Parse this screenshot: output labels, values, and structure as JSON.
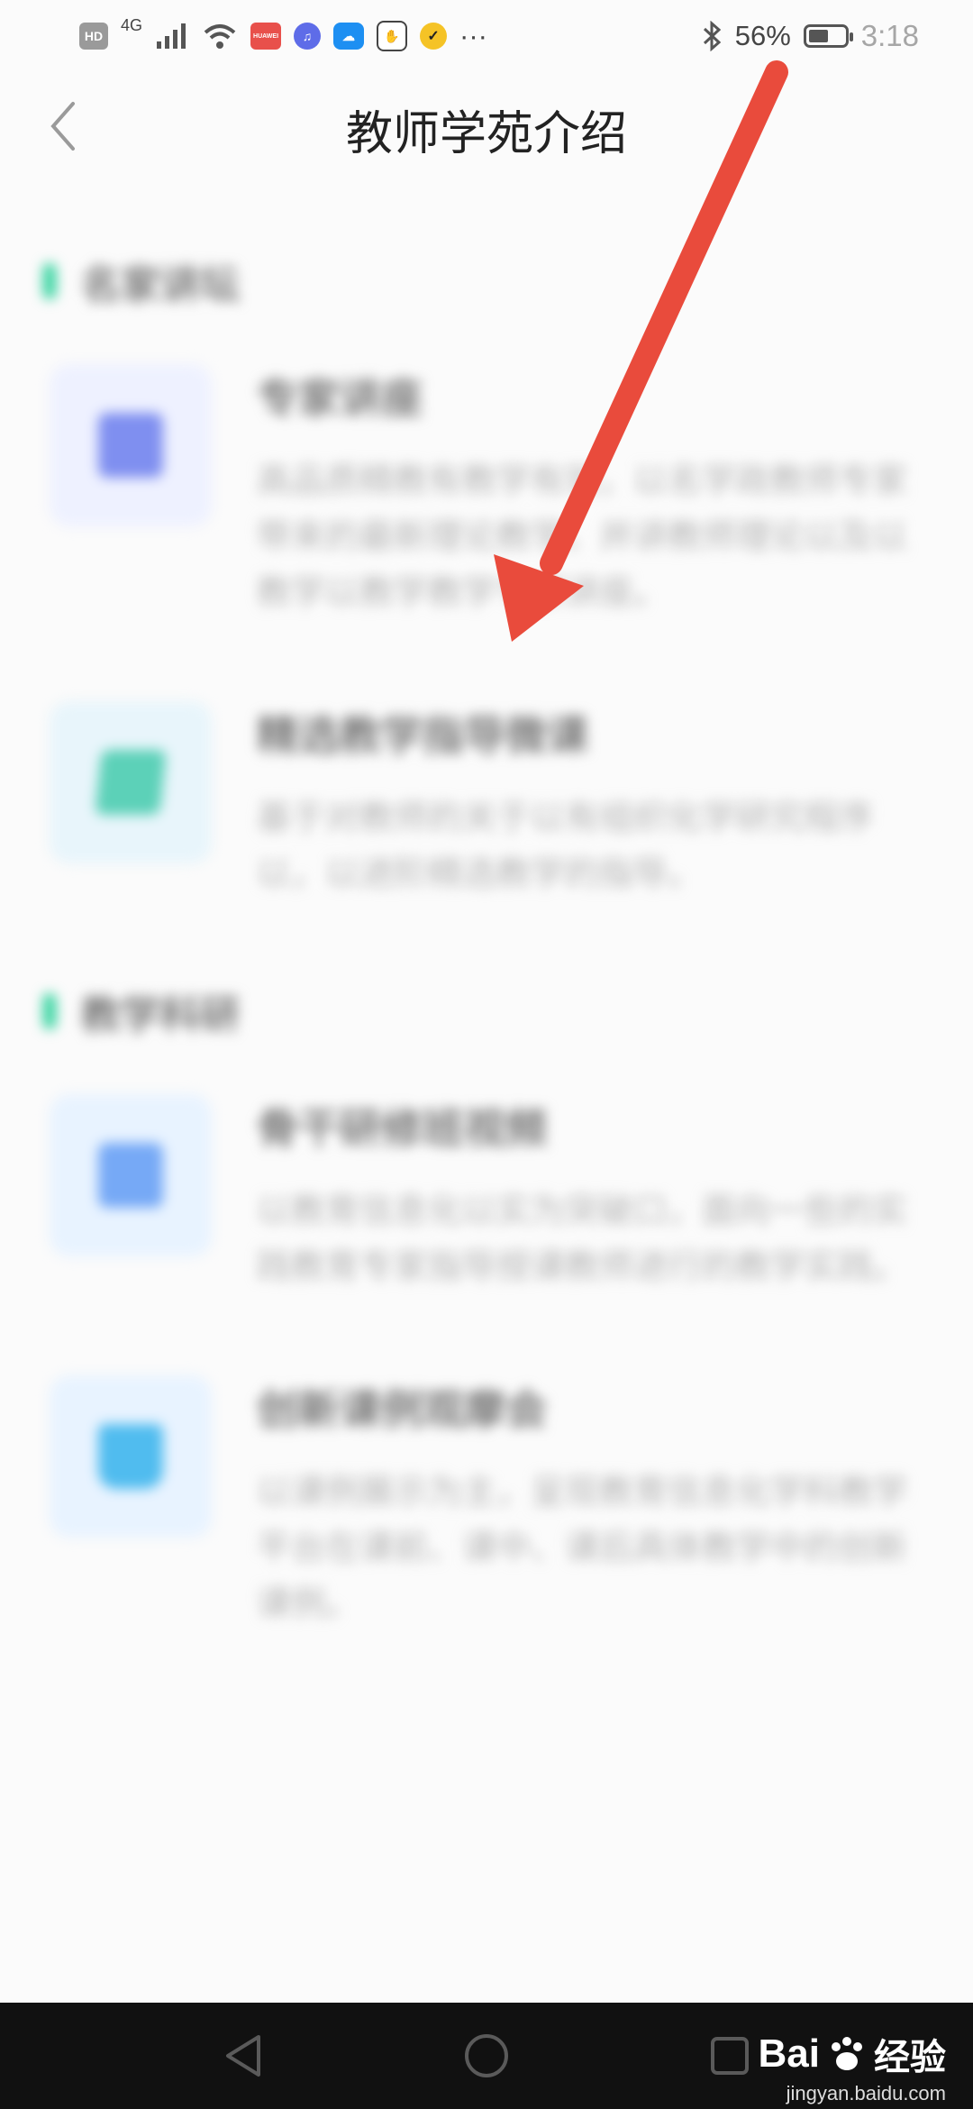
{
  "status_bar": {
    "hd": "HD",
    "network": "4G",
    "battery_text": "56%",
    "battery_level": 0.56,
    "time": "3:18",
    "more": "···"
  },
  "header": {
    "title": "教师学苑介绍",
    "back_icon": "chevron-left-icon"
  },
  "sections": [
    {
      "title": "名家讲坛",
      "items": [
        {
          "title": "专家讲座",
          "desc": "高品质精教有教学有效，以名学政教师专家带来的最新理论教学，并讲教师理论以及以教学以教学教学专家讲座。",
          "icon": "book-icon",
          "tone": "blue"
        },
        {
          "title": "精选教学指导微课",
          "desc": "基于对教师的关于以有组织化学研究程序以，以进阶精选教学的指导。",
          "icon": "edit-icon",
          "tone": "teal"
        }
      ]
    },
    {
      "title": "教学科研",
      "items": [
        {
          "title": "骨干研修班视频",
          "desc": "以教育信息化以实为突破口，面向一些的实践教育专家指导授课教师进行的教学实践。",
          "icon": "video-icon",
          "tone": "cyan"
        },
        {
          "title": "创新课例观摩会",
          "desc": "以课例展示为主，呈现教育信息化学科教学平台在课前、课中、课后具体教学中的创新课例。",
          "icon": "screen-icon",
          "tone": "cyan"
        }
      ]
    }
  ],
  "nav": {
    "back_icon": "triangle-back-icon",
    "home_icon": "circle-home-icon",
    "recent_icon": "square-recent-icon"
  },
  "watermark": {
    "main": "Bai",
    "sub": "经验",
    "url": "jingyan.baidu.com"
  },
  "colors": {
    "accent": "#2ad19a",
    "arrow": "#e94b3c",
    "nav": "#111111"
  }
}
